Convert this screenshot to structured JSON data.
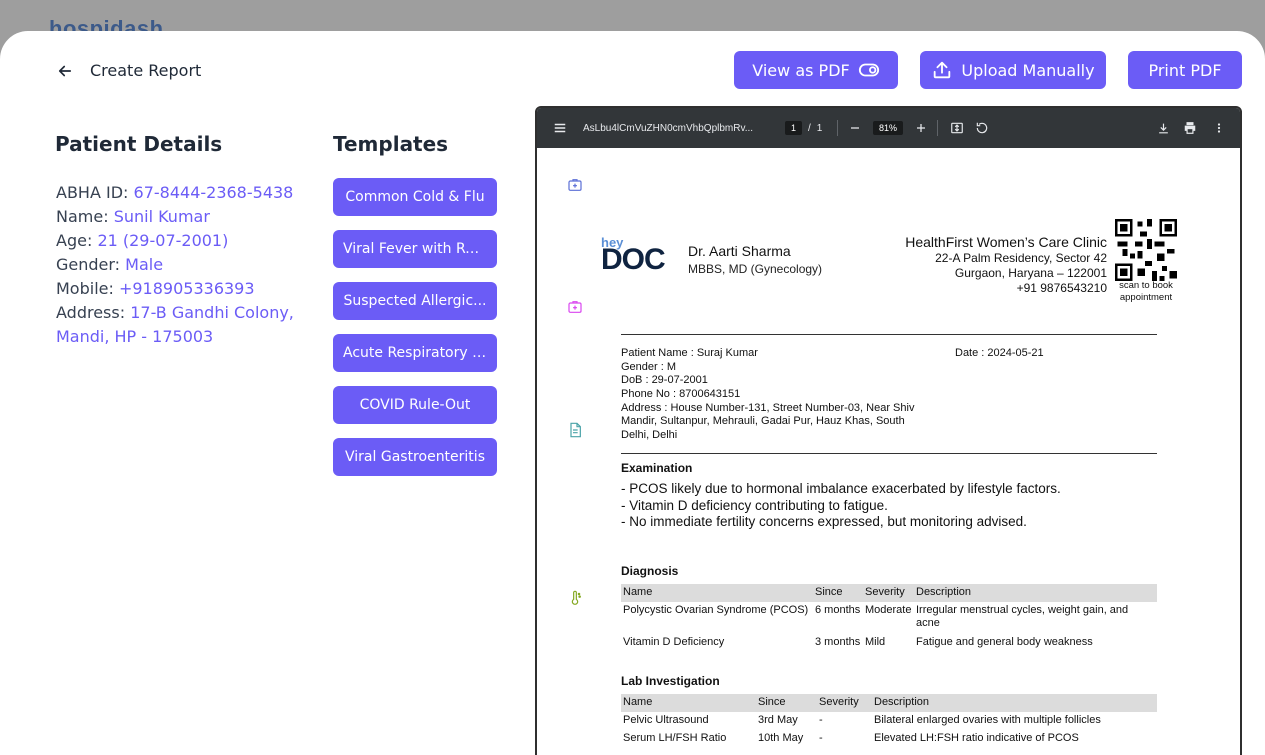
{
  "brand": {
    "logo_text": "hospidash"
  },
  "header": {
    "back_label": "Create Report",
    "buttons": {
      "view_pdf": "View as PDF",
      "upload": "Upload Manually",
      "print": "Print PDF"
    }
  },
  "patient": {
    "section_title": "Patient Details",
    "fields": [
      {
        "label": "ABHA ID:",
        "value": "67-8444-2368-5438"
      },
      {
        "label": "Name:",
        "value": "Sunil Kumar"
      },
      {
        "label": "Age:",
        "value": "21 (29-07-2001)"
      },
      {
        "label": "Gender:",
        "value": "Male"
      },
      {
        "label": "Mobile:",
        "value": "+918905336393"
      },
      {
        "label": "Address:",
        "value": "17-B Gandhi Colony, Mandi, HP - 175003"
      }
    ]
  },
  "templates": {
    "section_title": "Templates",
    "items": [
      "Common Cold & Flu",
      "Viral Fever with Res...",
      "Suspected Allergic...",
      "Acute Respiratory I...",
      "COVID Rule-Out",
      "Viral Gastroenteritis"
    ]
  },
  "viewer": {
    "filename": "AsLbu4lCmVuZHN0cmVhbQplbmRv...",
    "page_current": "1",
    "page_sep": "/",
    "page_total": "1",
    "zoom": "81%"
  },
  "report": {
    "brand_small": "hey",
    "brand_big": "DOC",
    "doctor_name": "Dr. Aarti Sharma",
    "doctor_degree": "MBBS, MD (Gynecology)",
    "clinic_name": "HealthFirst Women’s Care Clinic",
    "clinic_addr1": "22-A Palm Residency, Sector 42",
    "clinic_addr2": "Gurgaon, Haryana – 122001",
    "clinic_phone": "+91 9876543210",
    "qr_caption_1": "scan to book",
    "qr_caption_2": "appointment",
    "patient_name": "Patient Name : Suraj Kumar",
    "date": "Date : 2024-05-21",
    "gender": "Gender : M",
    "dob": "DoB : 29-07-2001",
    "phone": "Phone No : 8700643151",
    "address_1": "Address : House Number-131, Street Number-03, Near Shiv",
    "address_2": "Mandir, Sultanpur, Mehrauli, Gadai Pur, Hauz Khas, South",
    "address_3": "Delhi, Delhi",
    "exam_title": "Examination",
    "exam_lines": [
      "- PCOS likely due to hormonal imbalance exacerbated by lifestyle factors.",
      "- Vitamin D deficiency contributing to fatigue.",
      "- No immediate fertility concerns expressed, but monitoring advised."
    ],
    "diagnosis_title": "Diagnosis",
    "diagnosis_headers": [
      "Name",
      "Since",
      "Severity",
      "Description"
    ],
    "diagnosis_rows": [
      [
        "Polycystic Ovarian Syndrome (PCOS)",
        "6 months",
        "Moderate",
        "Irregular menstrual cycles, weight gain, and acne"
      ],
      [
        "Vitamin D Deficiency",
        "3 months",
        "Mild",
        "Fatigue and general body weakness"
      ]
    ],
    "lab_title": "Lab Investigation",
    "lab_headers": [
      "Name",
      "Since",
      "Severity",
      "Description"
    ],
    "lab_rows": [
      [
        "Pelvic Ultrasound",
        "3rd May",
        "-",
        "Bilateral enlarged ovaries with multiple follicles"
      ],
      [
        "Serum LH/FSH Ratio",
        "10th May",
        "-",
        "Elevated LH:FSH ratio indicative of PCOS"
      ]
    ]
  }
}
